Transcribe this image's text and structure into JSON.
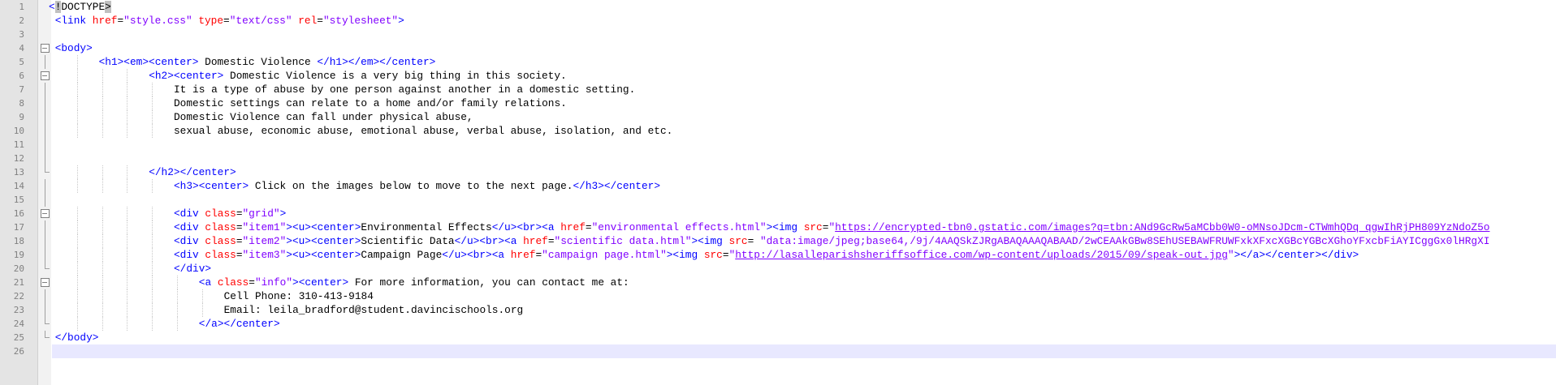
{
  "editor": {
    "current_line": 26,
    "lines": [
      {
        "num": "1",
        "fold": "",
        "indent": 0,
        "parts": [
          {
            "k": "tag",
            "t": "<"
          },
          {
            "k": "sel",
            "t": "!"
          },
          {
            "k": "txt",
            "t": "DOCTYPE"
          },
          {
            "k": "sel",
            "t": ">"
          }
        ]
      },
      {
        "num": "2",
        "fold": "",
        "indent": 1,
        "parts": [
          {
            "k": "tag",
            "t": "<link "
          },
          {
            "k": "attr",
            "t": "href"
          },
          {
            "k": "txt",
            "t": "="
          },
          {
            "k": "val",
            "t": "\"style.css\" "
          },
          {
            "k": "attr",
            "t": "type"
          },
          {
            "k": "txt",
            "t": "="
          },
          {
            "k": "val",
            "t": "\"text/css\" "
          },
          {
            "k": "attr",
            "t": "rel"
          },
          {
            "k": "txt",
            "t": "="
          },
          {
            "k": "val",
            "t": "\"stylesheet\""
          },
          {
            "k": "tag",
            "t": ">"
          }
        ]
      },
      {
        "num": "3",
        "fold": "",
        "indent": 0,
        "parts": []
      },
      {
        "num": "4",
        "fold": "box",
        "indent": 1,
        "parts": [
          {
            "k": "tag",
            "t": "<body>"
          }
        ]
      },
      {
        "num": "5",
        "fold": "vline",
        "indent": 8,
        "parts": [
          {
            "k": "tag",
            "t": "<h1><em><center>"
          },
          {
            "k": "txt",
            "t": " Domestic Violence "
          },
          {
            "k": "tag",
            "t": "</h1></em></center>"
          }
        ]
      },
      {
        "num": "6",
        "fold": "box",
        "indent": 16,
        "parts": [
          {
            "k": "tag",
            "t": "<h2><center>"
          },
          {
            "k": "txt",
            "t": " Domestic Violence is a very big thing in this society."
          }
        ]
      },
      {
        "num": "7",
        "fold": "vline",
        "indent": 20,
        "parts": [
          {
            "k": "txt",
            "t": "It is a type of abuse by one person against another in a domestic setting."
          }
        ]
      },
      {
        "num": "8",
        "fold": "vline",
        "indent": 20,
        "parts": [
          {
            "k": "txt",
            "t": "Domestic settings can relate to a home and/or family relations."
          }
        ]
      },
      {
        "num": "9",
        "fold": "vline",
        "indent": 20,
        "parts": [
          {
            "k": "txt",
            "t": "Domestic Violence can fall under physical abuse,"
          }
        ]
      },
      {
        "num": "10",
        "fold": "vline",
        "indent": 20,
        "parts": [
          {
            "k": "txt",
            "t": "sexual abuse, economic abuse, emotional abuse, verbal abuse, isolation, and etc."
          }
        ]
      },
      {
        "num": "11",
        "fold": "vline",
        "indent": 0,
        "parts": []
      },
      {
        "num": "12",
        "fold": "vline",
        "indent": 0,
        "parts": []
      },
      {
        "num": "13",
        "fold": "end",
        "indent": 16,
        "parts": [
          {
            "k": "tag",
            "t": "</h2></center>"
          }
        ]
      },
      {
        "num": "14",
        "fold": "vline",
        "indent": 20,
        "parts": [
          {
            "k": "tag",
            "t": "<h3><center>"
          },
          {
            "k": "txt",
            "t": " Click on the images below to move to the next page."
          },
          {
            "k": "tag",
            "t": "</h3></center>"
          }
        ]
      },
      {
        "num": "15",
        "fold": "vline",
        "indent": 0,
        "parts": []
      },
      {
        "num": "16",
        "fold": "box",
        "indent": 20,
        "parts": [
          {
            "k": "tag",
            "t": "<div "
          },
          {
            "k": "attr",
            "t": "class"
          },
          {
            "k": "txt",
            "t": "="
          },
          {
            "k": "val",
            "t": "\"grid\""
          },
          {
            "k": "tag",
            "t": ">"
          }
        ]
      },
      {
        "num": "17",
        "fold": "vline",
        "indent": 20,
        "parts": [
          {
            "k": "tag",
            "t": "<div "
          },
          {
            "k": "attr",
            "t": "class"
          },
          {
            "k": "txt",
            "t": "="
          },
          {
            "k": "val",
            "t": "\"item1\""
          },
          {
            "k": "tag",
            "t": "><u><center>"
          },
          {
            "k": "txt",
            "t": "Environmental Effects"
          },
          {
            "k": "tag",
            "t": "</u><br><a "
          },
          {
            "k": "attr",
            "t": "href"
          },
          {
            "k": "txt",
            "t": "="
          },
          {
            "k": "val",
            "t": "\"environmental effects.html\""
          },
          {
            "k": "tag",
            "t": "><img "
          },
          {
            "k": "attr",
            "t": "src"
          },
          {
            "k": "txt",
            "t": "="
          },
          {
            "k": "val",
            "t": "\""
          },
          {
            "k": "url",
            "t": "https://encrypted-tbn0.gstatic.com/images?q=tbn:ANd9GcRw5aMCbb0W0-oMNsoJDcm-CTWmhQDq_qgwIhRjPH809YzNdoZ5o"
          }
        ]
      },
      {
        "num": "18",
        "fold": "vline",
        "indent": 20,
        "parts": [
          {
            "k": "tag",
            "t": "<div "
          },
          {
            "k": "attr",
            "t": "class"
          },
          {
            "k": "txt",
            "t": "="
          },
          {
            "k": "val",
            "t": "\"item2\""
          },
          {
            "k": "tag",
            "t": "><u><center>"
          },
          {
            "k": "txt",
            "t": "Scientific Data"
          },
          {
            "k": "tag",
            "t": "</u><br><a "
          },
          {
            "k": "attr",
            "t": "href"
          },
          {
            "k": "txt",
            "t": "="
          },
          {
            "k": "val",
            "t": "\"scientific data.html\""
          },
          {
            "k": "tag",
            "t": "><img "
          },
          {
            "k": "attr",
            "t": "src"
          },
          {
            "k": "txt",
            "t": "= "
          },
          {
            "k": "val",
            "t": "\"data:image/jpeg;base64,/9j/4AAQSkZJRgABAQAAAQABAAD/2wCEAAkGBw8SEhUSEBAWFRUWFxkXFxcXGBcYGBcXGhoYFxcbFiAYICggGx0lHRgXI"
          }
        ]
      },
      {
        "num": "19",
        "fold": "vline",
        "indent": 20,
        "parts": [
          {
            "k": "tag",
            "t": "<div "
          },
          {
            "k": "attr",
            "t": "class"
          },
          {
            "k": "txt",
            "t": "="
          },
          {
            "k": "val",
            "t": "\"item3\""
          },
          {
            "k": "tag",
            "t": "><u><center>"
          },
          {
            "k": "txt",
            "t": "Campaign Page"
          },
          {
            "k": "tag",
            "t": "</u><br><a "
          },
          {
            "k": "attr",
            "t": "href"
          },
          {
            "k": "txt",
            "t": "="
          },
          {
            "k": "val",
            "t": "\"campaign page.html\""
          },
          {
            "k": "tag",
            "t": "><img "
          },
          {
            "k": "attr",
            "t": "src"
          },
          {
            "k": "txt",
            "t": "="
          },
          {
            "k": "val",
            "t": "\""
          },
          {
            "k": "url",
            "t": "http://lasalleparishsheriffsoffice.com/wp-content/uploads/2015/09/speak-out.jpg"
          },
          {
            "k": "val",
            "t": "\""
          },
          {
            "k": "tag",
            "t": "></a></center></div>"
          }
        ]
      },
      {
        "num": "20",
        "fold": "end",
        "indent": 20,
        "parts": [
          {
            "k": "tag",
            "t": "</div>"
          }
        ]
      },
      {
        "num": "21",
        "fold": "box",
        "indent": 24,
        "parts": [
          {
            "k": "tag",
            "t": "<a "
          },
          {
            "k": "attr",
            "t": "class"
          },
          {
            "k": "txt",
            "t": "="
          },
          {
            "k": "val",
            "t": "\"info\""
          },
          {
            "k": "tag",
            "t": "><center>"
          },
          {
            "k": "txt",
            "t": " For more information, you can contact me at:"
          }
        ]
      },
      {
        "num": "22",
        "fold": "vline",
        "indent": 28,
        "parts": [
          {
            "k": "txt",
            "t": "Cell Phone: 310-413-9184"
          }
        ]
      },
      {
        "num": "23",
        "fold": "vline",
        "indent": 28,
        "parts": [
          {
            "k": "txt",
            "t": "Email: leila_bradford@student.davincischools.org"
          }
        ]
      },
      {
        "num": "24",
        "fold": "end",
        "indent": 24,
        "parts": [
          {
            "k": "tag",
            "t": "</a></center>"
          }
        ]
      },
      {
        "num": "25",
        "fold": "end",
        "indent": 1,
        "parts": [
          {
            "k": "tag",
            "t": "</body>"
          }
        ]
      },
      {
        "num": "26",
        "fold": "",
        "indent": 0,
        "parts": []
      }
    ]
  },
  "colors": {
    "tag": "#0000ff",
    "attribute": "#ff0000",
    "value": "#8000ff",
    "text": "#000000",
    "current_line": "#e8e8ff",
    "gutter": "#e4e4e4"
  }
}
